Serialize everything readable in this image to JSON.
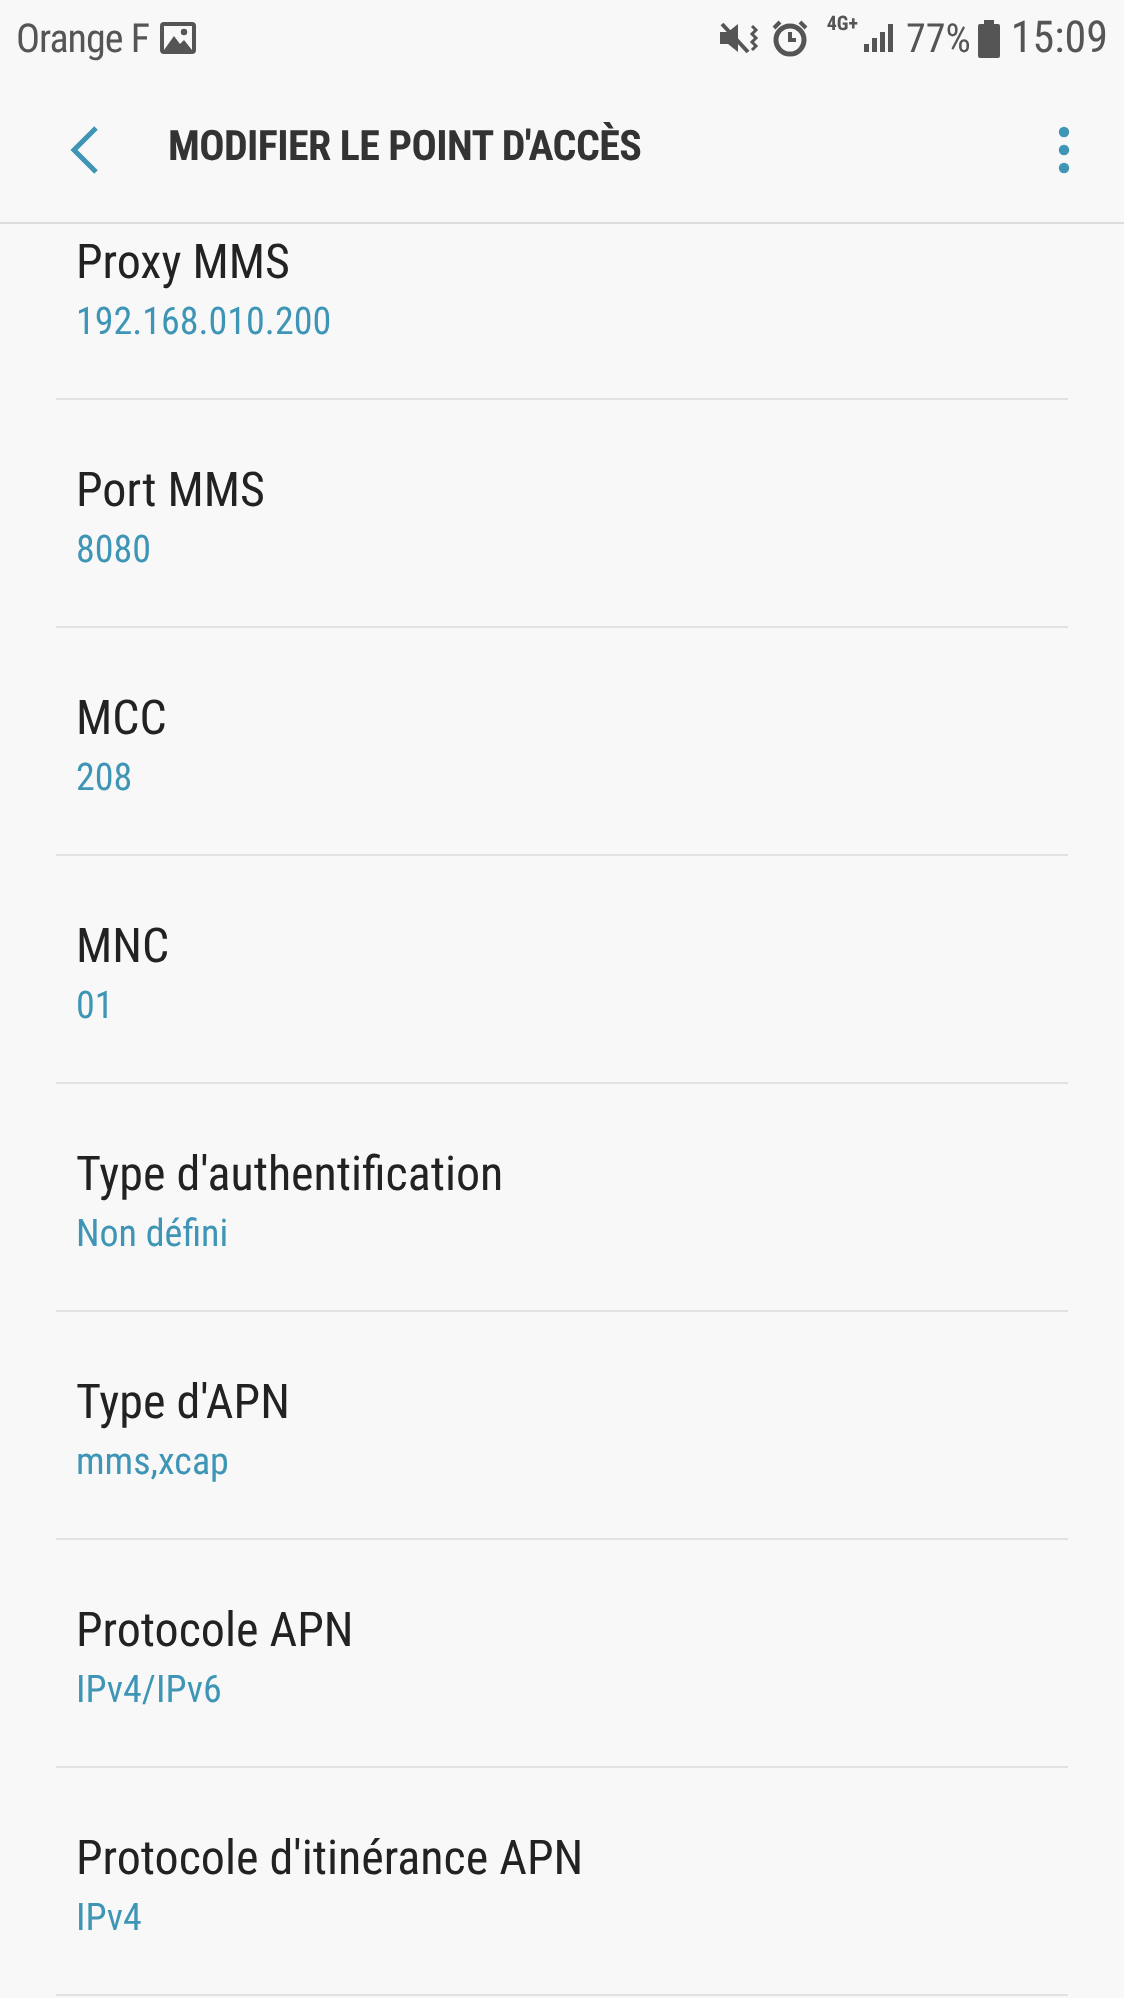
{
  "status_bar": {
    "carrier": "Orange F",
    "network": "4G+",
    "battery": "77%",
    "time": "15:09"
  },
  "header": {
    "title": "MODIFIER LE POINT D'ACCÈS"
  },
  "settings": [
    {
      "label": "Proxy MMS",
      "value": "192.168.010.200"
    },
    {
      "label": "Port MMS",
      "value": "8080"
    },
    {
      "label": "MCC",
      "value": "208"
    },
    {
      "label": "MNC",
      "value": "01"
    },
    {
      "label": "Type d'authentification",
      "value": "Non défini"
    },
    {
      "label": "Type d'APN",
      "value": "mms,xcap"
    },
    {
      "label": "Protocole APN",
      "value": "IPv4/IPv6"
    },
    {
      "label": "Protocole d'itinérance APN",
      "value": "IPv4"
    }
  ]
}
